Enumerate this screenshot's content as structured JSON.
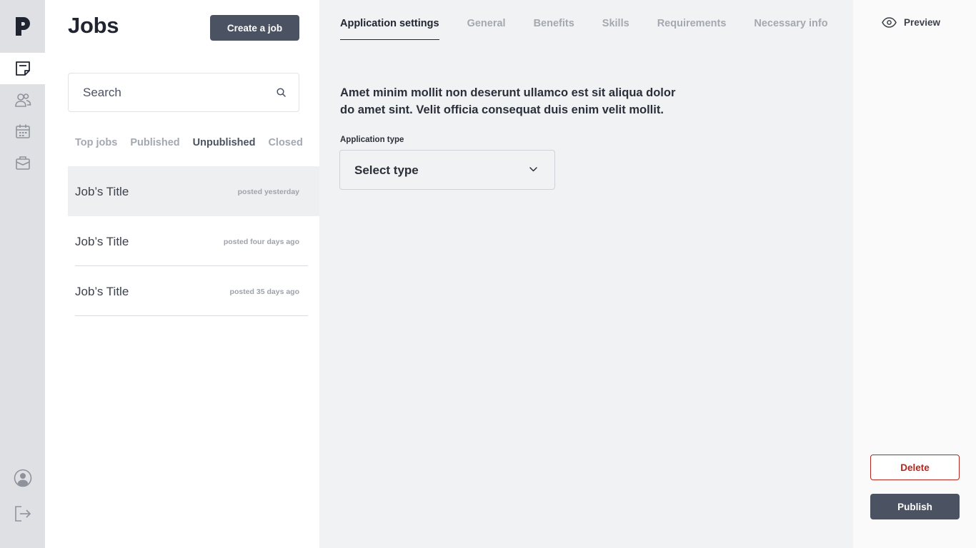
{
  "sidebar": {
    "logo_letter": "P",
    "items": [
      {
        "icon": "document-icon",
        "active": true
      },
      {
        "icon": "users-icon",
        "active": false
      },
      {
        "icon": "calendar-icon",
        "active": false
      },
      {
        "icon": "briefcase-icon",
        "active": false
      }
    ],
    "bottom_items": [
      {
        "icon": "profile-icon"
      },
      {
        "icon": "logout-icon"
      }
    ]
  },
  "jobs": {
    "title": "Jobs",
    "create_label": "Create a job",
    "search": {
      "placeholder": "Search",
      "value": ""
    },
    "filters": [
      {
        "label": "Top jobs",
        "active": false
      },
      {
        "label": "Published",
        "active": false
      },
      {
        "label": "Unpublished",
        "active": true
      },
      {
        "label": "Closed",
        "active": false
      }
    ],
    "list": [
      {
        "title": "Job’s Title",
        "meta": "posted yesterday",
        "active": true
      },
      {
        "title": "Job’s Title",
        "meta": "posted four days ago",
        "active": false
      },
      {
        "title": "Job’s Title",
        "meta": "posted 35 days ago",
        "active": false
      }
    ]
  },
  "main": {
    "tabs": [
      {
        "label": "Application settings",
        "active": true
      },
      {
        "label": "General",
        "active": false
      },
      {
        "label": "Benefits",
        "active": false
      },
      {
        "label": "Skills",
        "active": false
      },
      {
        "label": "Requirements",
        "active": false
      },
      {
        "label": "Necessary info",
        "active": false
      }
    ],
    "description": "Amet minim mollit non deserunt ullamco est sit aliqua dolor do amet sint. Velit officia consequat duis enim velit mollit.",
    "application_type": {
      "label": "Application type",
      "value": "Select type"
    }
  },
  "right": {
    "preview_label": "Preview",
    "delete_label": "Delete",
    "publish_label": "Publish"
  },
  "colors": {
    "rail_bg": "#dfe0e3",
    "primary_button": "#4b5261",
    "danger": "#b3261e",
    "main_bg": "#f1f2f4"
  }
}
